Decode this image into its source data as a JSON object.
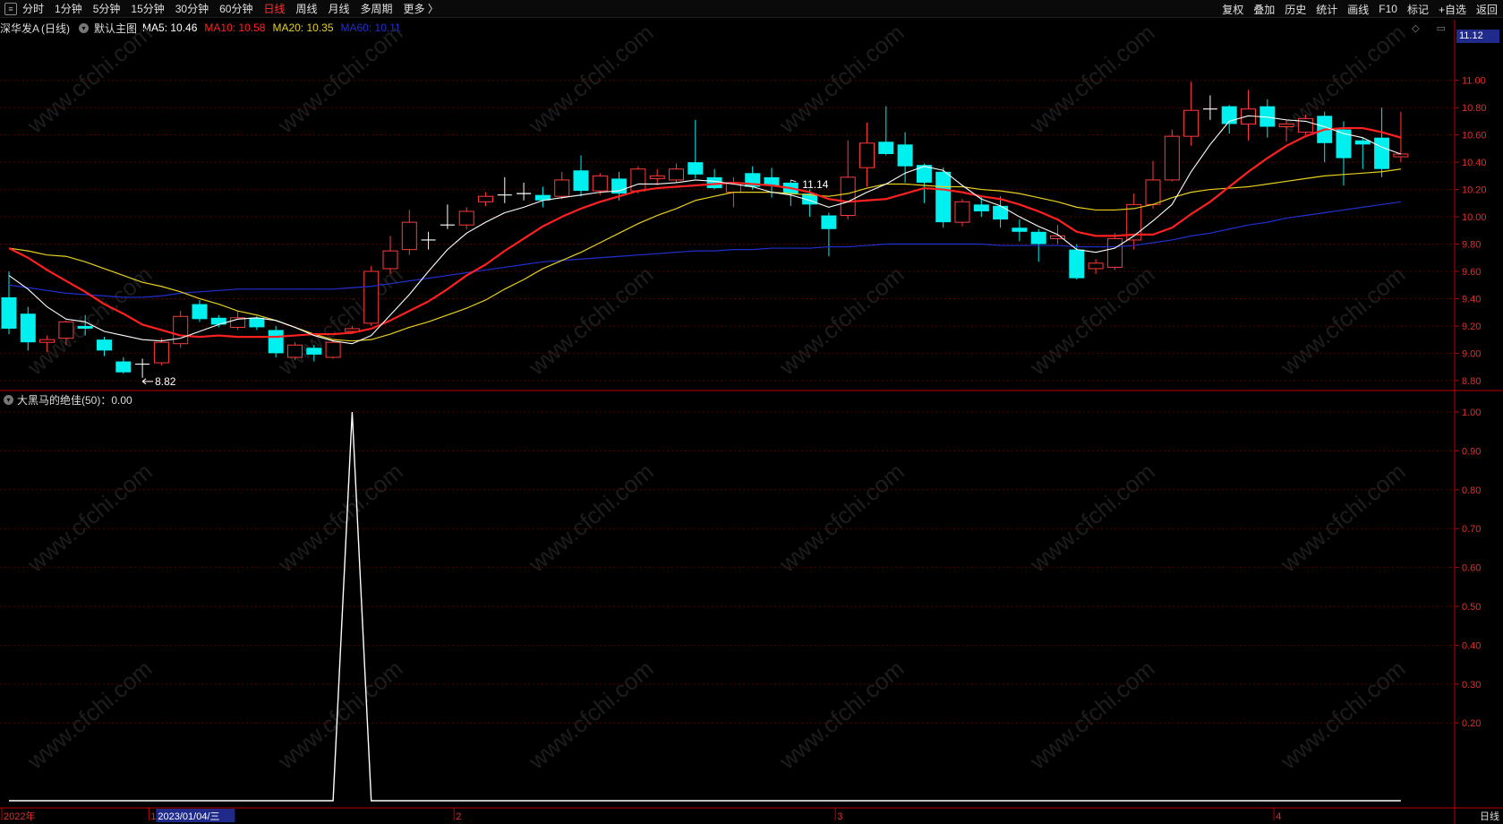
{
  "toolbar": {
    "left_items": [
      "分时",
      "1分钟",
      "5分钟",
      "15分钟",
      "30分钟",
      "60分钟",
      "日线",
      "周线",
      "月线",
      "多周期",
      "更多 〉"
    ],
    "active_item": "日线",
    "right_items": [
      "复权",
      "叠加",
      "历史",
      "统计",
      "画线",
      "F10",
      "标记",
      "+自选",
      "返回"
    ]
  },
  "main_pane": {
    "stock_name": "深华发A",
    "period": "(日线)",
    "template": "默认主图",
    "ma": [
      {
        "label": "MA5: 10.46",
        "color": "#ffffff"
      },
      {
        "label": "MA10: 10.58",
        "color": "#ff2020"
      },
      {
        "label": "MA20: 10.35",
        "color": "#e8d020"
      },
      {
        "label": "MA60: 10.11",
        "color": "#2030d0"
      }
    ],
    "current_price": "11.12",
    "high_marker": "11.14",
    "low_marker": "8.82",
    "corner_icons": "◇ ▭"
  },
  "sub_pane": {
    "indicator": "大黑马的绝佳(50)：0.00"
  },
  "x_axis": {
    "labels": [
      {
        "text": "2022年",
        "idx": 0
      },
      {
        "text": "1",
        "idx": 8
      },
      {
        "text": "2023/01/04/三",
        "idx": 8,
        "highlight": true
      },
      {
        "text": "2",
        "idx": 24
      },
      {
        "text": "3",
        "idx": 44
      },
      {
        "text": "4",
        "idx": 67
      }
    ],
    "period_label": "日线"
  },
  "watermark": "www.cfchi.com",
  "colors": {
    "up": "#ff3b3b",
    "down": "#00f0f0",
    "cross": "#ffffff",
    "ma5": "#ffffff",
    "ma10": "#ff2020",
    "ma20": "#e8d020",
    "ma60": "#2030d0",
    "axis": "#c00000",
    "grid": "#5a0000"
  },
  "chart_data": {
    "type": "candlestick",
    "price_axis": {
      "ticks": [
        "11.00",
        "10.80",
        "10.60",
        "10.40",
        "10.20",
        "10.00",
        "9.80",
        "9.60",
        "9.40",
        "9.20",
        "9.00",
        "8.80"
      ],
      "ylim": [
        8.74,
        11.3
      ]
    },
    "sub_axis": {
      "ticks": [
        "1.00",
        "0.90",
        "0.80",
        "0.70",
        "0.60",
        "0.50",
        "0.40",
        "0.30",
        "0.20"
      ],
      "ylim": [
        0,
        1.0
      ]
    },
    "candles": [
      [
        9.41,
        9.18,
        9.6,
        9.14
      ],
      [
        9.29,
        9.08,
        9.34,
        9.02
      ],
      [
        9.08,
        9.1,
        9.13,
        9.01
      ],
      [
        9.11,
        9.23,
        9.24,
        9.06
      ],
      [
        9.2,
        9.18,
        9.28,
        9.13
      ],
      [
        9.1,
        9.02,
        9.12,
        8.98
      ],
      [
        8.94,
        8.86,
        8.97,
        8.85
      ],
      [
        8.92,
        8.91,
        8.96,
        8.82
      ],
      [
        8.93,
        9.08,
        9.11,
        8.91
      ],
      [
        9.07,
        9.27,
        9.31,
        9.04
      ],
      [
        9.36,
        9.25,
        9.39,
        9.23
      ],
      [
        9.26,
        9.21,
        9.28,
        9.19
      ],
      [
        9.19,
        9.26,
        9.31,
        9.17
      ],
      [
        9.26,
        9.19,
        9.27,
        9.17
      ],
      [
        9.17,
        9.0,
        9.2,
        8.97
      ],
      [
        8.97,
        9.06,
        9.08,
        8.95
      ],
      [
        9.04,
        8.99,
        9.06,
        8.94
      ],
      [
        8.97,
        9.08,
        9.09,
        8.96
      ],
      [
        9.16,
        9.18,
        9.2,
        9.14
      ],
      [
        9.22,
        9.6,
        9.64,
        9.2
      ],
      [
        9.62,
        9.75,
        9.86,
        9.58
      ],
      [
        9.76,
        9.96,
        10.05,
        9.72
      ],
      [
        9.83,
        9.83,
        9.89,
        9.76
      ],
      [
        9.93,
        9.94,
        10.09,
        9.91
      ],
      [
        9.94,
        10.04,
        10.07,
        9.91
      ],
      [
        10.11,
        10.15,
        10.18,
        10.08
      ],
      [
        10.16,
        10.16,
        10.29,
        10.1
      ],
      [
        10.17,
        10.16,
        10.25,
        10.12
      ],
      [
        10.16,
        10.12,
        10.22,
        10.07
      ],
      [
        10.15,
        10.27,
        10.33,
        10.13
      ],
      [
        10.34,
        10.19,
        10.45,
        10.15
      ],
      [
        10.19,
        10.3,
        10.32,
        10.16
      ],
      [
        10.28,
        10.17,
        10.33,
        10.12
      ],
      [
        10.19,
        10.35,
        10.37,
        10.17
      ],
      [
        10.28,
        10.3,
        10.35,
        10.23
      ],
      [
        10.27,
        10.35,
        10.39,
        10.25
      ],
      [
        10.4,
        10.31,
        10.71,
        10.28
      ],
      [
        10.29,
        10.21,
        10.35,
        10.2
      ],
      [
        10.18,
        10.25,
        10.29,
        10.07
      ],
      [
        10.32,
        10.22,
        10.37,
        10.2
      ],
      [
        10.29,
        10.23,
        10.36,
        10.14
      ],
      [
        10.25,
        10.17,
        10.27,
        10.08
      ],
      [
        10.17,
        10.09,
        10.2,
        10.0
      ],
      [
        10.01,
        9.91,
        10.03,
        9.71
      ],
      [
        10.01,
        10.29,
        10.56,
        9.98
      ],
      [
        10.36,
        10.54,
        10.69,
        10.22
      ],
      [
        10.55,
        10.46,
        10.81,
        10.45
      ],
      [
        10.53,
        10.37,
        10.62,
        10.25
      ],
      [
        10.38,
        10.25,
        10.39,
        10.1
      ],
      [
        10.33,
        9.96,
        10.36,
        9.92
      ],
      [
        9.96,
        10.11,
        10.13,
        9.93
      ],
      [
        10.09,
        10.04,
        10.15,
        10.0
      ],
      [
        10.08,
        9.98,
        10.15,
        9.92
      ],
      [
        9.92,
        9.89,
        9.98,
        9.82
      ],
      [
        9.89,
        9.8,
        9.91,
        9.67
      ],
      [
        9.84,
        9.86,
        9.94,
        9.8
      ],
      [
        9.76,
        9.55,
        9.8,
        9.54
      ],
      [
        9.62,
        9.66,
        9.69,
        9.58
      ],
      [
        9.63,
        9.84,
        9.88,
        9.61
      ],
      [
        9.83,
        10.09,
        10.17,
        9.76
      ],
      [
        10.09,
        10.27,
        10.41,
        10.06
      ],
      [
        10.27,
        10.59,
        10.64,
        10.26
      ],
      [
        10.59,
        10.78,
        10.99,
        10.52
      ],
      [
        10.79,
        10.79,
        10.89,
        10.71
      ],
      [
        10.81,
        10.68,
        10.82,
        10.61
      ],
      [
        10.68,
        10.79,
        10.93,
        10.56
      ],
      [
        10.81,
        10.66,
        10.86,
        10.58
      ],
      [
        10.66,
        10.68,
        10.71,
        10.55
      ],
      [
        10.62,
        10.72,
        10.75,
        10.6
      ],
      [
        10.74,
        10.54,
        10.77,
        10.4
      ],
      [
        10.64,
        10.43,
        10.7,
        10.23
      ],
      [
        10.56,
        10.53,
        10.58,
        10.35
      ],
      [
        10.58,
        10.35,
        10.8,
        10.29
      ],
      [
        10.44,
        10.46,
        10.77,
        10.4
      ]
    ],
    "ma5": [
      9.57,
      9.47,
      9.34,
      9.25,
      9.23,
      9.16,
      9.13,
      9.1,
      9.09,
      9.11,
      9.16,
      9.21,
      9.25,
      9.26,
      9.24,
      9.19,
      9.13,
      9.09,
      9.07,
      9.13,
      9.28,
      9.43,
      9.6,
      9.76,
      9.88,
      9.96,
      10.03,
      10.07,
      10.12,
      10.14,
      10.16,
      10.18,
      10.19,
      10.24,
      10.24,
      10.25,
      10.27,
      10.26,
      10.24,
      10.22,
      10.18,
      10.16,
      10.12,
      10.07,
      10.11,
      10.18,
      10.24,
      10.32,
      10.37,
      10.34,
      10.23,
      10.13,
      10.08,
      10.0,
      9.93,
      9.87,
      9.76,
      9.74,
      9.77,
      9.86,
      9.97,
      10.09,
      10.33,
      10.53,
      10.7,
      10.74,
      10.73,
      10.71,
      10.7,
      10.66,
      10.61,
      10.58,
      10.51,
      10.46
    ],
    "ma10": [
      9.77,
      9.7,
      9.61,
      9.53,
      9.45,
      9.36,
      9.29,
      9.21,
      9.17,
      9.13,
      9.12,
      9.13,
      9.12,
      9.12,
      9.12,
      9.13,
      9.14,
      9.14,
      9.15,
      9.18,
      9.24,
      9.31,
      9.38,
      9.47,
      9.57,
      9.65,
      9.75,
      9.84,
      9.93,
      10.0,
      10.06,
      10.11,
      10.15,
      10.19,
      10.21,
      10.22,
      10.23,
      10.24,
      10.25,
      10.24,
      10.23,
      10.21,
      10.18,
      10.13,
      10.11,
      10.12,
      10.13,
      10.17,
      10.21,
      10.2,
      10.18,
      10.15,
      10.13,
      10.09,
      10.04,
      9.98,
      9.89,
      9.86,
      9.86,
      9.87,
      9.87,
      9.92,
      10.02,
      10.11,
      10.22,
      10.33,
      10.43,
      10.52,
      10.59,
      10.64,
      10.65,
      10.65,
      10.62,
      10.58
    ],
    "ma20": [
      9.77,
      9.75,
      9.72,
      9.71,
      9.67,
      9.62,
      9.57,
      9.52,
      9.49,
      9.45,
      9.4,
      9.36,
      9.31,
      9.28,
      9.24,
      9.19,
      9.14,
      9.1,
      9.09,
      9.1,
      9.14,
      9.19,
      9.23,
      9.28,
      9.33,
      9.39,
      9.47,
      9.54,
      9.62,
      9.68,
      9.74,
      9.81,
      9.88,
      9.95,
      10.01,
      10.06,
      10.12,
      10.15,
      10.18,
      10.18,
      10.18,
      10.17,
      10.16,
      10.15,
      10.17,
      10.21,
      10.24,
      10.24,
      10.23,
      10.22,
      10.22,
      10.2,
      10.19,
      10.17,
      10.14,
      10.11,
      10.07,
      10.05,
      10.05,
      10.06,
      10.09,
      10.14,
      10.18,
      10.2,
      10.21,
      10.22,
      10.24,
      10.26,
      10.28,
      10.3,
      10.31,
      10.32,
      10.33,
      10.35
    ],
    "ma60": [
      9.5,
      9.48,
      9.46,
      9.44,
      9.43,
      9.42,
      9.41,
      9.41,
      9.42,
      9.44,
      9.45,
      9.46,
      9.47,
      9.47,
      9.47,
      9.47,
      9.47,
      9.47,
      9.48,
      9.49,
      9.51,
      9.53,
      9.55,
      9.57,
      9.59,
      9.61,
      9.63,
      9.65,
      9.67,
      9.68,
      9.69,
      9.7,
      9.71,
      9.72,
      9.73,
      9.74,
      9.75,
      9.75,
      9.76,
      9.76,
      9.77,
      9.77,
      9.77,
      9.78,
      9.78,
      9.79,
      9.8,
      9.8,
      9.8,
      9.8,
      9.8,
      9.8,
      9.79,
      9.79,
      9.79,
      9.79,
      9.78,
      9.78,
      9.78,
      9.79,
      9.81,
      9.83,
      9.86,
      9.88,
      9.91,
      9.94,
      9.96,
      9.99,
      10.01,
      10.03,
      10.05,
      10.07,
      10.09,
      10.11
    ],
    "indicator_values": [
      0,
      0,
      0,
      0,
      0,
      0,
      0,
      0,
      0,
      0,
      0,
      0,
      0,
      0,
      0,
      0,
      0,
      0,
      1,
      0,
      0,
      0,
      0,
      0,
      0,
      0,
      0,
      0,
      0,
      0,
      0,
      0,
      0,
      0,
      0,
      0,
      0,
      0,
      0,
      0,
      0,
      0,
      0,
      0,
      0,
      0,
      0,
      0,
      0,
      0,
      0,
      0,
      0,
      0,
      0,
      0,
      0,
      0,
      0,
      0,
      0,
      0,
      0,
      0,
      0,
      0,
      0,
      0,
      0,
      0,
      0,
      0,
      0,
      0
    ],
    "high_marker_idx": 41,
    "low_marker_idx": 7
  }
}
